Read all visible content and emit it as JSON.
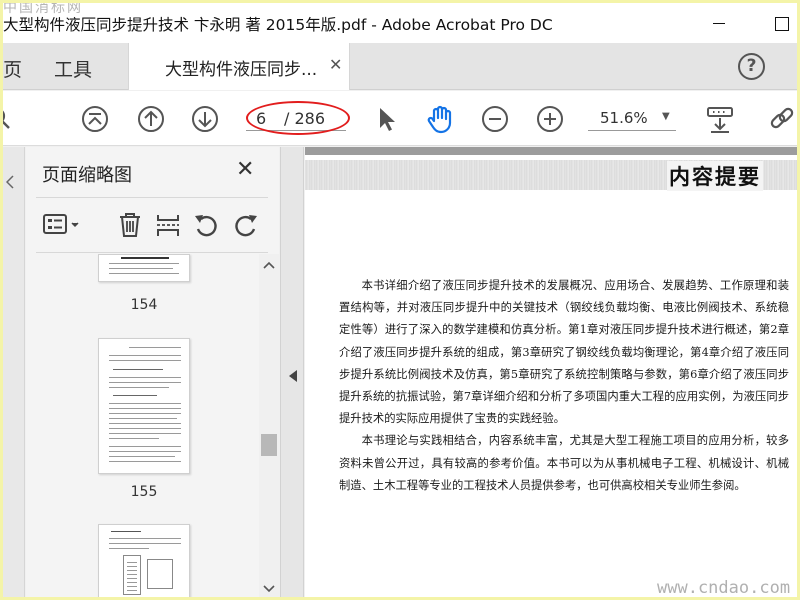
{
  "window": {
    "title": "大型构件液压同步提升技术 卞永明 著 2015年版.pdf - Adobe Acrobat Pro DC",
    "watermark_top": "中国消标网"
  },
  "tabs": {
    "home": "页",
    "tools": "工具",
    "document": "大型构件液压同步...",
    "help": "?"
  },
  "toolbar": {
    "page_current": "6",
    "page_total": "/ 286",
    "zoom": "51.6%"
  },
  "thumbnails": {
    "title": "页面缩略图",
    "pages": [
      {
        "num": "154"
      },
      {
        "num": "155"
      },
      {
        "num": ""
      }
    ]
  },
  "document": {
    "heading": "内容提要",
    "paragraphs": [
      "本书详细介绍了液压同步提升技术的发展概况、应用场合、发展趋势、工作原理和装置结构等，并对液压同步提升中的关键技术（钢绞线负载均衡、电液比例阀技术、系统稳定性等）进行了深入的数学建模和仿真分析。第1章对液压同步提升技术进行概述，第2章介绍了液压同步提升系统的组成，第3章研究了钢绞线负载均衡理论，第4章介绍了液压同步提升系统比例阀技术及仿真，第5章研究了系统控制策略与参数，第6章介绍了液压同步提升系统的抗振试验，第7章详细介绍和分析了多项国内重大工程的应用实例，为液压同步提升技术的实际应用提供了宝贵的实践经验。",
      "本书理论与实践相结合，内容系统丰富，尤其是大型工程施工项目的应用分析，较多资料未曾公开过，具有较高的参考价值。本书可以为从事机械电子工程、机械设计、机械制造、土木工程等专业的工程技术人员提供参考，也可供高校相关专业师生参阅。"
    ],
    "watermark": "www.cndao.com"
  },
  "colors": {
    "annotation_oval": "#e21d1d",
    "hand_tool": "#1473e6",
    "outer_border": "#f4f4a8"
  }
}
